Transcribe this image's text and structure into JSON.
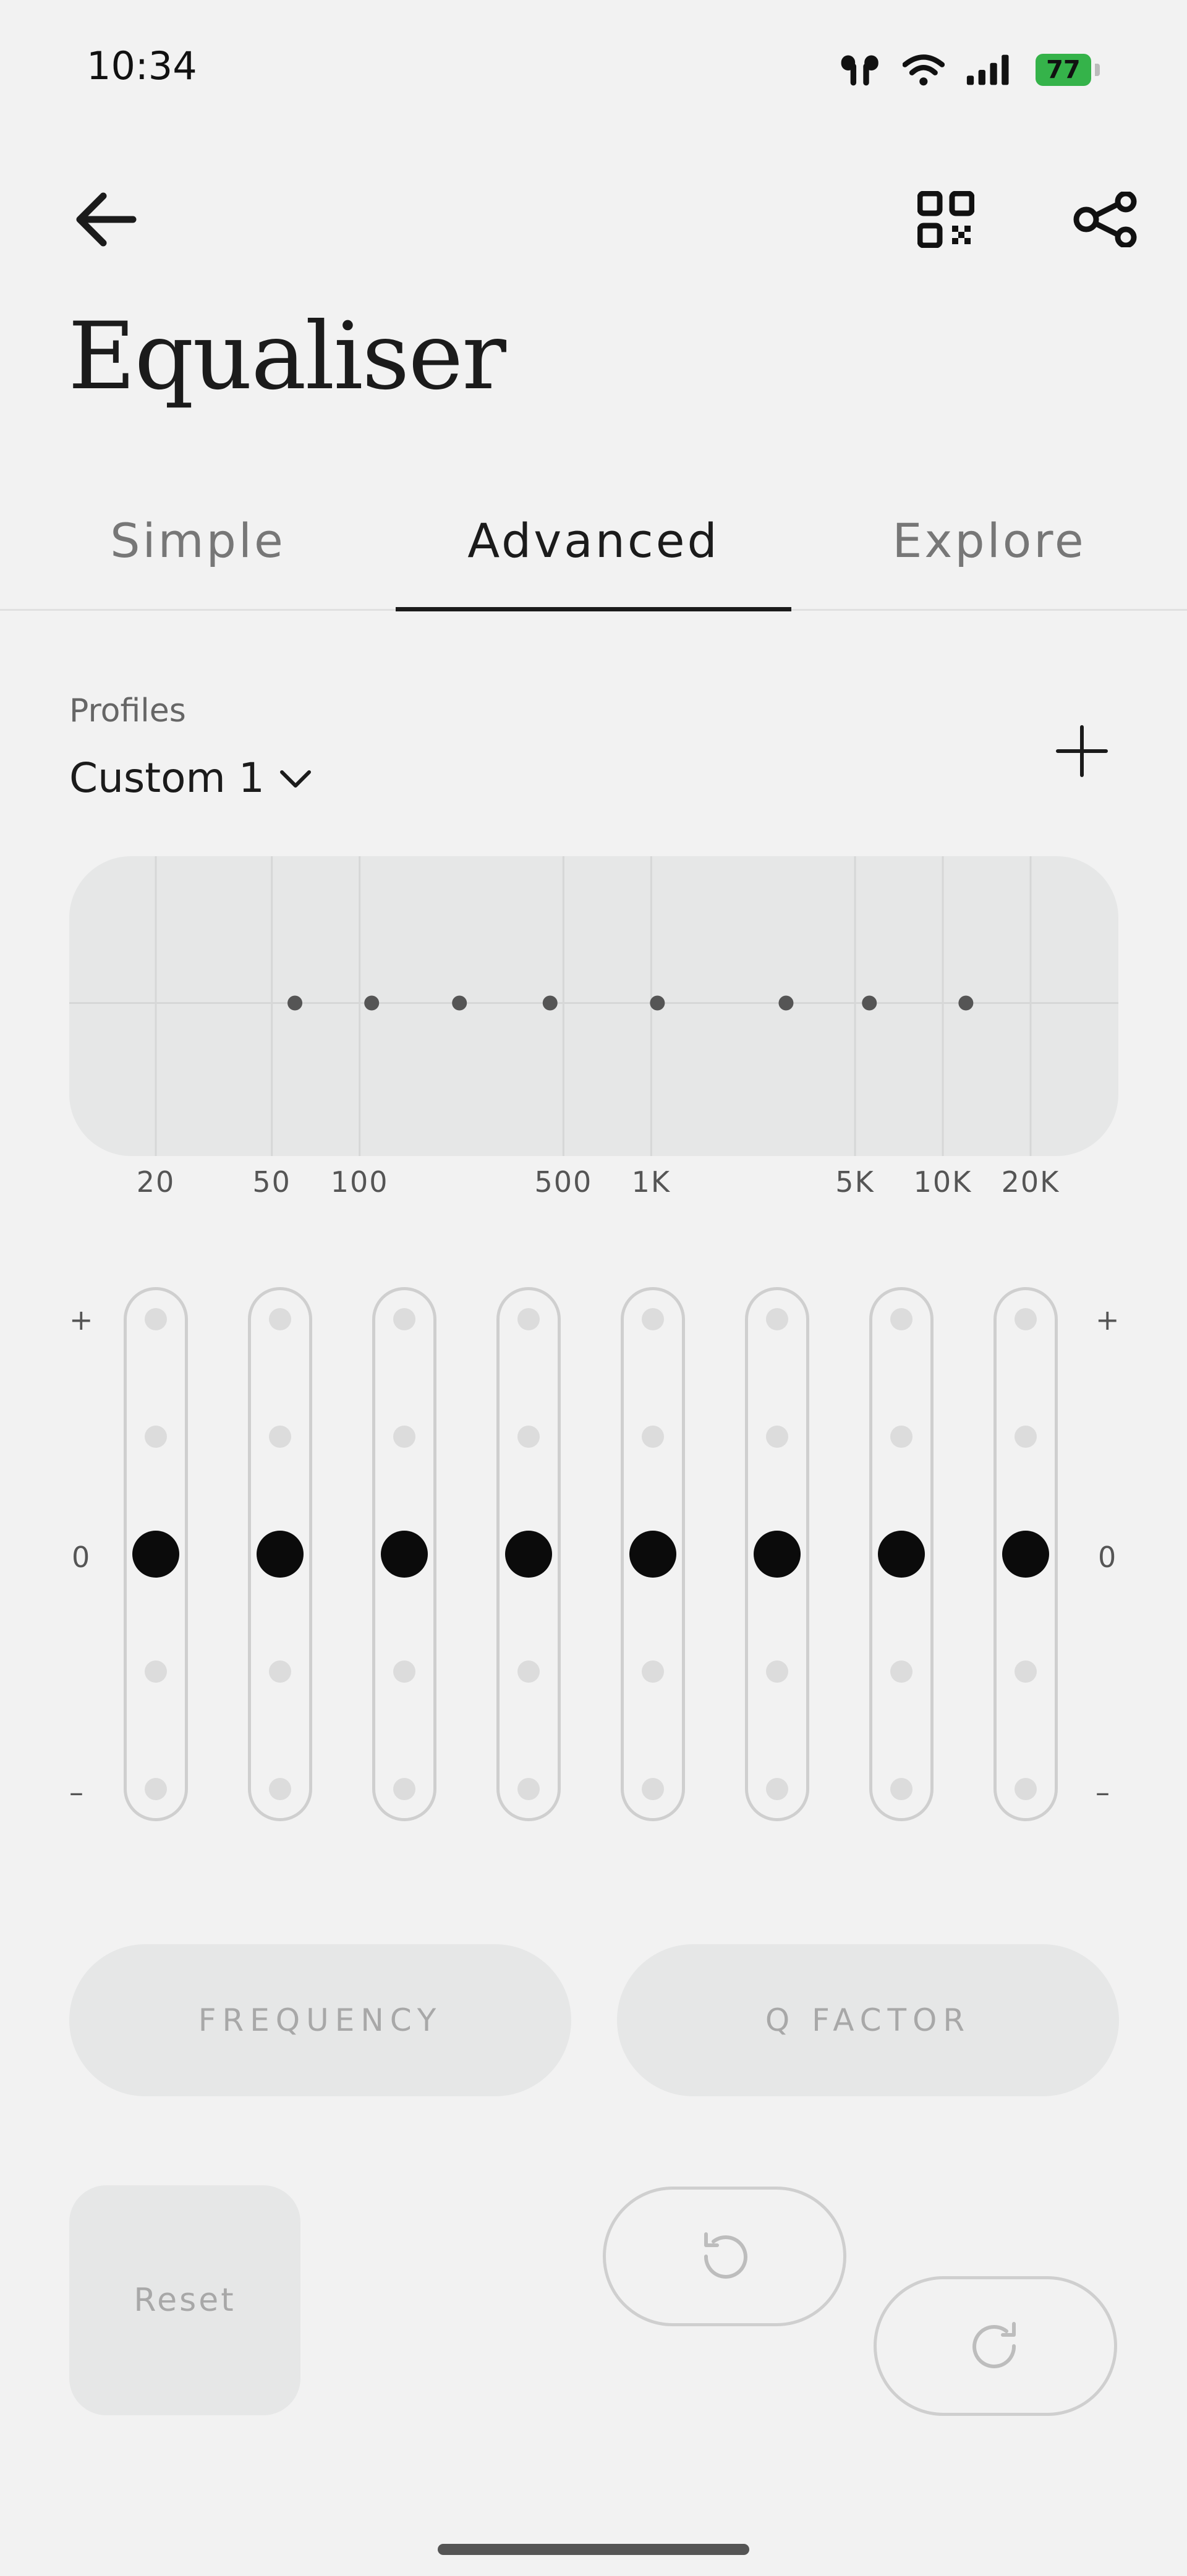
{
  "status_bar": {
    "time": "10:34",
    "battery": "77",
    "icons": [
      "earbuds-icon",
      "wifi-icon",
      "signal-icon",
      "battery-icon"
    ]
  },
  "header": {
    "title": "Equaliser",
    "icons": [
      "back-arrow-icon",
      "qr-code-icon",
      "share-icon"
    ]
  },
  "tabs": [
    {
      "label": "Simple",
      "active": false
    },
    {
      "label": "Advanced",
      "active": true
    },
    {
      "label": "Explore",
      "active": false
    }
  ],
  "profiles": {
    "label": "Profiles",
    "selected": "Custom 1",
    "add_icon": "plus-icon"
  },
  "eq_chart": {
    "frequency_labels": [
      "20",
      "50",
      "100",
      "500",
      "1K",
      "5K",
      "10K",
      "20K"
    ],
    "band_frequencies_hz": [
      60,
      110,
      220,
      450,
      1050,
      2900,
      5600,
      12000
    ],
    "band_gains": [
      0,
      0,
      0,
      0,
      0,
      0,
      0,
      0
    ]
  },
  "sliders": {
    "plus_label": "+",
    "zero_label": "0",
    "minus_label": "–",
    "count": 8,
    "values": [
      0,
      0,
      0,
      0,
      0,
      0,
      0,
      0
    ]
  },
  "buttons": {
    "frequency": "FREQUENCY",
    "q_factor": "Q  FACTOR",
    "reset": "Reset",
    "undo_icon": "undo-icon",
    "redo_icon": "redo-icon"
  },
  "colors": {
    "background": "#f2f2f2",
    "panel": "#e6e7e7",
    "thumb": "#0b0b0b",
    "battery": "#35b34a"
  }
}
